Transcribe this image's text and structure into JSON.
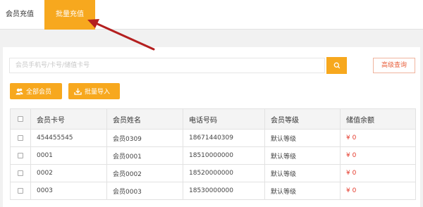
{
  "tabs": [
    {
      "label": "会员充值",
      "active": false
    },
    {
      "label": "批量充值",
      "active": true
    }
  ],
  "search": {
    "placeholder": "会员手机号/卡号/储值卡号",
    "button_icon": "search-icon",
    "advanced_label": "高级查询"
  },
  "actions": {
    "all_members_label": "全部会员",
    "batch_import_label": "批量导入"
  },
  "table": {
    "headers": [
      "会员卡号",
      "会员姓名",
      "电话号码",
      "会员等级",
      "储值余额"
    ],
    "rows": [
      {
        "card": "454455545",
        "name": "会员0309",
        "phone": "18671440309",
        "level": "默认等级",
        "balance": "¥ 0"
      },
      {
        "card": "0001",
        "name": "会员0001",
        "phone": "18510000000",
        "level": "默认等级",
        "balance": "¥ 0"
      },
      {
        "card": "0002",
        "name": "会员0002",
        "phone": "18520000000",
        "level": "默认等级",
        "balance": "¥ 0"
      },
      {
        "card": "0003",
        "name": "会员0003",
        "phone": "18530000000",
        "level": "默认等级",
        "balance": "¥ 0"
      }
    ]
  },
  "colors": {
    "accent": "#f7a81e",
    "arrow": "#b41f1f",
    "balance": "#e53a2b"
  }
}
